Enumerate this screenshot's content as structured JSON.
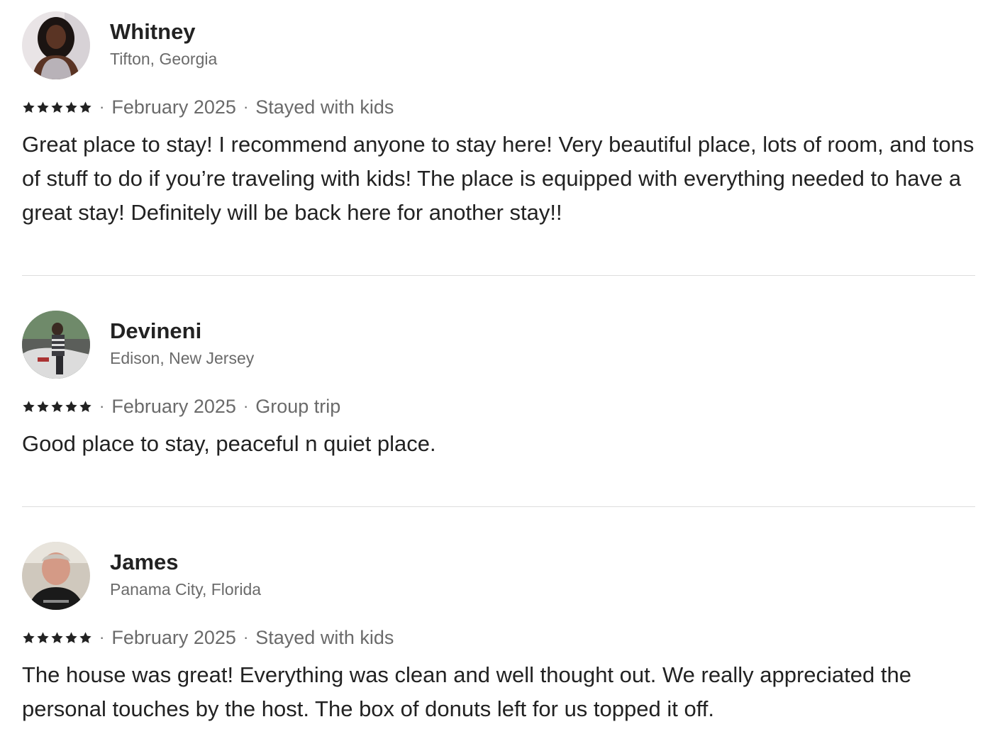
{
  "reviews": [
    {
      "name": "Whitney",
      "location": "Tifton, Georgia",
      "rating": 5,
      "date": "February 2025",
      "trip_type": "Stayed with kids",
      "text": "Great place to stay! I recommend anyone to stay here! Very beautiful place, lots of room, and tons of stuff to do if you’re traveling with kids! The place is equipped with everything needed to have a great stay! Definitely will be back here for another stay!!"
    },
    {
      "name": "Devineni",
      "location": "Edison, New Jersey",
      "rating": 5,
      "date": "February 2025",
      "trip_type": "Group trip",
      "text": "Good place to stay, peaceful n quiet place."
    },
    {
      "name": "James",
      "location": "Panama City, Florida",
      "rating": 5,
      "date": "February 2025",
      "trip_type": "Stayed with kids",
      "text": "The house was great! Everything was clean and well thought out. We really appreciated the personal touches by the host. The box of donuts left for us topped it off."
    }
  ],
  "separator": "·",
  "icons": {
    "star": "star-icon"
  },
  "colors": {
    "primary_text": "#222222",
    "secondary_text": "#6a6a6a",
    "divider": "#dddddd"
  }
}
